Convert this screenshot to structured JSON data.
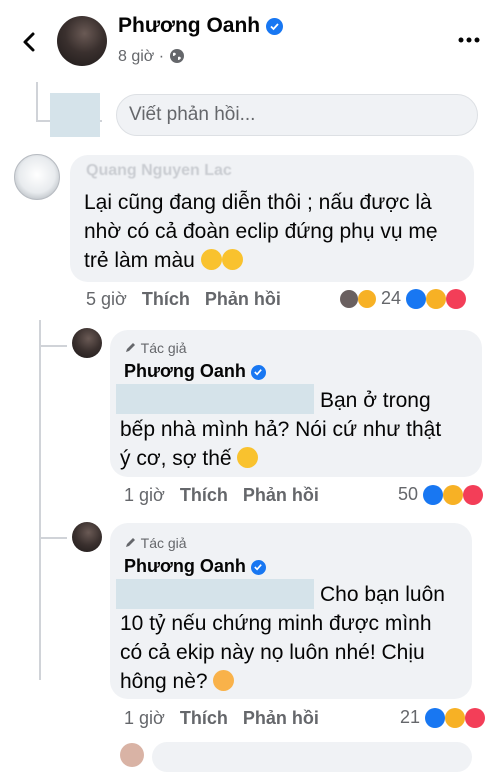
{
  "header": {
    "name": "Phương Oanh",
    "time": "8 giờ",
    "separator": "·"
  },
  "reply_input": {
    "placeholder": "Viết phản hồi..."
  },
  "comment1": {
    "name_faded": "Quang Nguyen Lac",
    "text_lines": [
      "Lại cũng đang diễn thôi ; nấu được là",
      "nhờ có cả đoàn eclip đứng phụ vụ mẹ",
      "trẻ làm màu"
    ],
    "time": "5 giờ",
    "like": "Thích",
    "reply": "Phản hồi",
    "reaction_count": "24"
  },
  "reply1": {
    "author_tag": "Tác giả",
    "name": "Phương Oanh",
    "text_lines": [
      "Bạn ở trong",
      "bếp nhà mình hả? Nói cứ như thật",
      "ý cơ, sợ thế"
    ],
    "time": "1 giờ",
    "like": "Thích",
    "reply": "Phản hồi",
    "reaction_count": "50"
  },
  "reply2": {
    "author_tag": "Tác giả",
    "name": "Phương Oanh",
    "text_lines": [
      "Cho bạn luôn",
      "10 tỷ nếu chứng minh được mình",
      "có cả ekip này nọ luôn nhé! Chịu",
      "hông nè?"
    ],
    "time": "1 giờ",
    "like": "Thích",
    "reply": "Phản hồi",
    "reaction_count": "21"
  },
  "icons": [
    "back-arrow-icon",
    "verified-icon",
    "globe-icon",
    "more-icon",
    "pencil-icon",
    "haha-icon",
    "like-icon",
    "love-icon",
    "smiling-hearts-icon"
  ],
  "colors": {
    "verified": "#1877f2",
    "bubble": "#f0f2f5",
    "meta": "#65676b",
    "redaction": "#d5e3ea"
  }
}
